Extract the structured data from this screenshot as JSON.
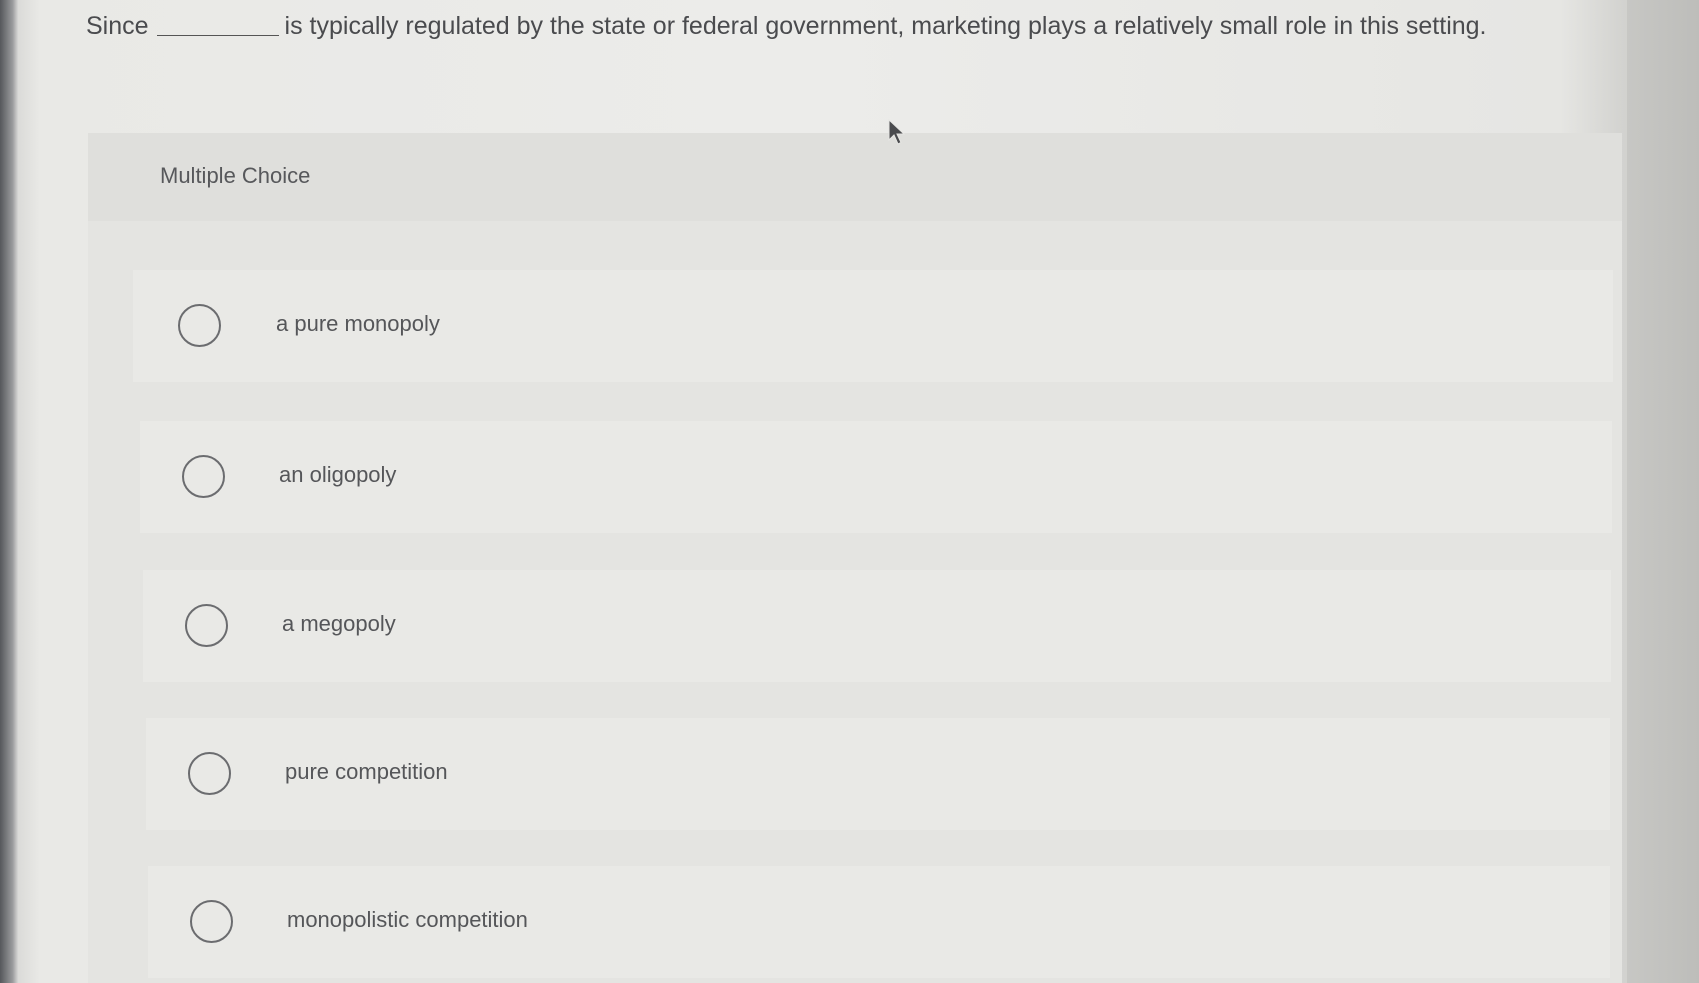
{
  "question": {
    "prefix": "Since",
    "suffix": "is typically regulated by the state or federal government, marketing plays a relatively small role in this setting."
  },
  "section_label": "Multiple Choice",
  "options": [
    {
      "label": "a pure monopoly",
      "selected": false
    },
    {
      "label": "an oligopoly",
      "selected": false
    },
    {
      "label": "a megopoly",
      "selected": false
    },
    {
      "label": "pure competition",
      "selected": false
    },
    {
      "label": "monopolistic competition",
      "selected": false
    }
  ],
  "icons": {
    "radio": "radio-circle-icon",
    "cursor": "mouse-pointer-icon"
  }
}
